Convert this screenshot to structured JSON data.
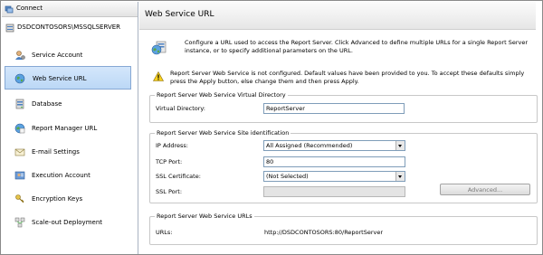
{
  "sidebar": {
    "connect_label": "Connect",
    "server_name": "DSDCONTOSORS\\MSSQLSERVER",
    "items": [
      {
        "label": "Service Account",
        "icon": "service-account-icon"
      },
      {
        "label": "Web Service URL",
        "icon": "globe-icon",
        "selected": true
      },
      {
        "label": "Database",
        "icon": "database-icon"
      },
      {
        "label": "Report Manager URL",
        "icon": "report-manager-icon"
      },
      {
        "label": "E-mail Settings",
        "icon": "email-icon"
      },
      {
        "label": "Execution Account",
        "icon": "execution-account-icon"
      },
      {
        "label": "Encryption Keys",
        "icon": "key-icon"
      },
      {
        "label": "Scale-out Deployment",
        "icon": "scale-out-icon"
      }
    ]
  },
  "main": {
    "title": "Web Service URL",
    "intro": "Configure a URL used to access the Report Server.  Click Advanced to define multiple URLs for a single Report Server instance, or to specify additional parameters on the URL.",
    "warning": "Report Server Web Service is not configured. Default values have been provided to you. To accept these defaults simply press the Apply button, else change them and then press Apply.",
    "virtual_directory_group": {
      "title": "Report Server Web Service Virtual Directory",
      "label": "Virtual Directory:",
      "value": "ReportServer"
    },
    "site_identification_group": {
      "title": "Report Server Web Service Site identification",
      "ip_label": "IP Address:",
      "ip_value": "All Assigned (Recommended)",
      "tcp_label": "TCP Port:",
      "tcp_value": "80",
      "ssl_cert_label": "SSL Certificate:",
      "ssl_cert_value": "(Not Selected)",
      "ssl_port_label": "SSL Port:",
      "ssl_port_value": "",
      "advanced_label": "Advanced..."
    },
    "urls_group": {
      "title": "Report Server Web Service URLs",
      "label": "URLs:",
      "value": "http://DSDCONTOSORS:80/ReportServer"
    }
  },
  "colors": {
    "selected_bg": "#c8dff8",
    "selected_border": "#86a8d4",
    "input_border": "#7f9db9",
    "warning_yellow": "#f5cf1d"
  }
}
